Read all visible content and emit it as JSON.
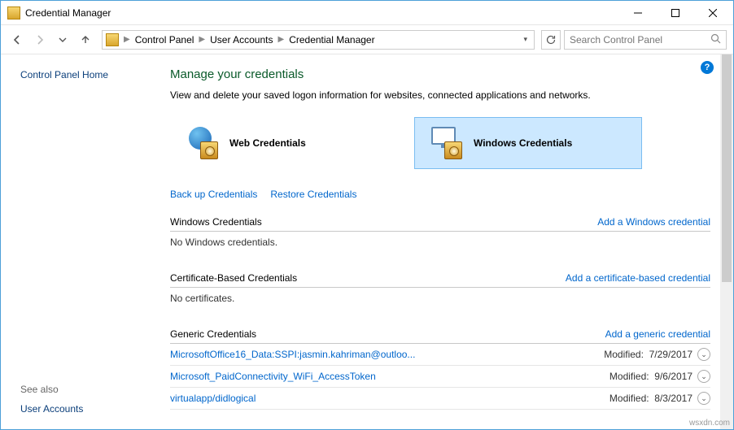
{
  "window": {
    "title": "Credential Manager"
  },
  "breadcrumb": {
    "root": "Control Panel",
    "level1": "User Accounts",
    "level2": "Credential Manager"
  },
  "search": {
    "placeholder": "Search Control Panel"
  },
  "sidebar": {
    "home": "Control Panel Home",
    "seealso_label": "See also",
    "seealso_link": "User Accounts"
  },
  "page": {
    "title": "Manage your credentials",
    "desc": "View and delete your saved logon information for websites, connected applications and networks."
  },
  "cred_types": {
    "web": "Web Credentials",
    "windows": "Windows Credentials"
  },
  "actions": {
    "backup": "Back up Credentials",
    "restore": "Restore Credentials"
  },
  "sections": {
    "windows": {
      "name": "Windows Credentials",
      "add": "Add a Windows credential",
      "empty": "No Windows credentials."
    },
    "cert": {
      "name": "Certificate-Based Credentials",
      "add": "Add a certificate-based credential",
      "empty": "No certificates."
    },
    "generic": {
      "name": "Generic Credentials",
      "add": "Add a generic credential",
      "modified_label": "Modified:",
      "items": [
        {
          "name": "MicrosoftOffice16_Data:SSPI:jasmin.kahriman@outloo...",
          "modified": "7/29/2017"
        },
        {
          "name": "Microsoft_PaidConnectivity_WiFi_AccessToken",
          "modified": "9/6/2017"
        },
        {
          "name": "virtualapp/didlogical",
          "modified": "8/3/2017"
        }
      ]
    }
  },
  "watermark": "wsxdn.com"
}
